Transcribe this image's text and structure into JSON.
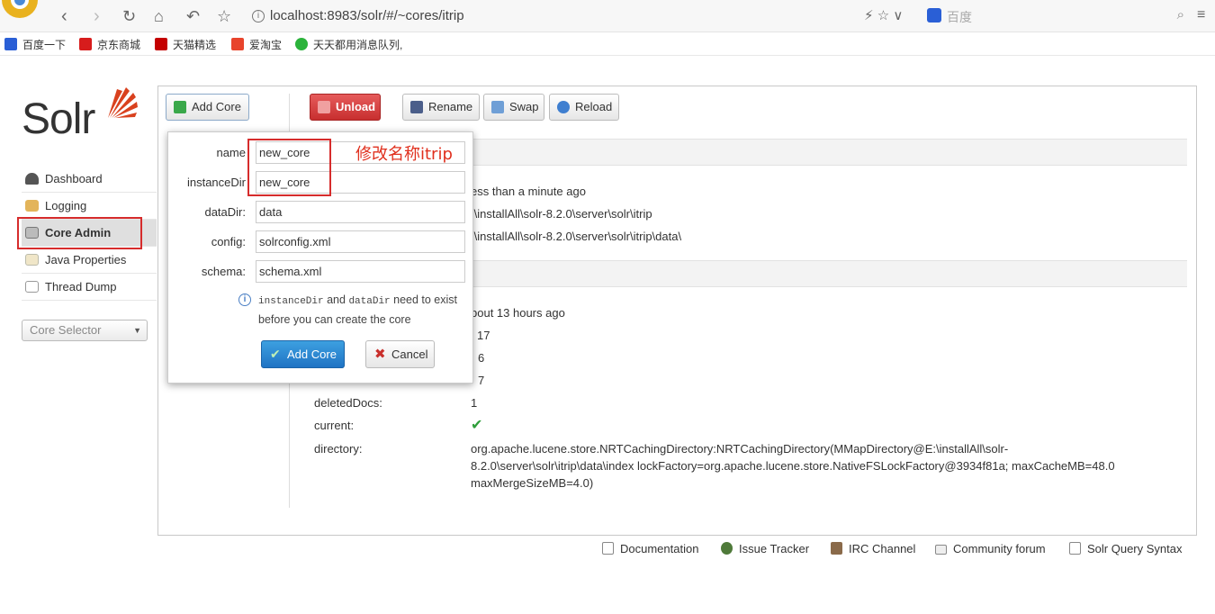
{
  "browser": {
    "url": "localhost:8983/solr/#/~cores/itrip",
    "search_placeholder": "百度",
    "bookmarks": [
      "百度一下",
      "京东商城",
      "天猫精选",
      "爱淘宝",
      "天天都用消息队列,"
    ]
  },
  "sidebar": {
    "logo_text": "Solr",
    "items": [
      {
        "label": "Dashboard",
        "active": false
      },
      {
        "label": "Logging",
        "active": false
      },
      {
        "label": "Core Admin",
        "active": true
      },
      {
        "label": "Java Properties",
        "active": false
      },
      {
        "label": "Thread Dump",
        "active": false
      }
    ],
    "core_selector_placeholder": "Core Selector"
  },
  "toolbar": {
    "add_core_label": "Add Core",
    "unload_label": "Unload",
    "rename_label": "Rename",
    "swap_label": "Swap",
    "reload_label": "Reload"
  },
  "core_info": {
    "started": "ess than a minute ago",
    "instance_dir": ":\\installAll\\solr-8.2.0\\server\\solr\\itrip",
    "data_dir": ":\\installAll\\solr-8.2.0\\server\\solr\\itrip\\data\\",
    "last_modified": "bout 13 hours ago",
    "version": "17",
    "num_docs": "6",
    "max_doc": "7",
    "deleted_docs_key": "deletedDocs:",
    "deleted_docs": "1",
    "current_key": "current:",
    "current_icon": "check-icon",
    "directory_key": "directory:",
    "directory": "org.apache.lucene.store.NRTCachingDirectory:NRTCachingDirectory(MMapDirectory@E:\\installAll\\solr-8.2.0\\server\\solr\\itrip\\data\\index lockFactory=org.apache.lucene.store.NativeFSLockFactory@3934f81a; maxCacheMB=48.0 maxMergeSizeMB=4.0)"
  },
  "popup": {
    "fields": [
      {
        "label": "name",
        "value": "new_core"
      },
      {
        "label": "instanceDir",
        "value": "new_core"
      },
      {
        "label": "dataDir:",
        "value": "data"
      },
      {
        "label": "config:",
        "value": "solrconfig.xml"
      },
      {
        "label": "schema:",
        "value": "schema.xml"
      }
    ],
    "note_mono_1": "instanceDir",
    "note_and": " and ",
    "note_mono_2": "dataDir",
    "note_rest": " need to exist before you can create the core",
    "add_core_label": "Add Core",
    "cancel_label": "Cancel"
  },
  "annotation_text": "修改名称itrip",
  "footer": {
    "links": [
      "Documentation",
      "Issue Tracker",
      "IRC Channel",
      "Community forum",
      "Solr Query Syntax"
    ]
  },
  "colors": {
    "annotation_red": "#e0301e",
    "unload_red": "#d03a3a",
    "primary_blue": "#1f73c4",
    "check_green": "#2e9e3a"
  }
}
